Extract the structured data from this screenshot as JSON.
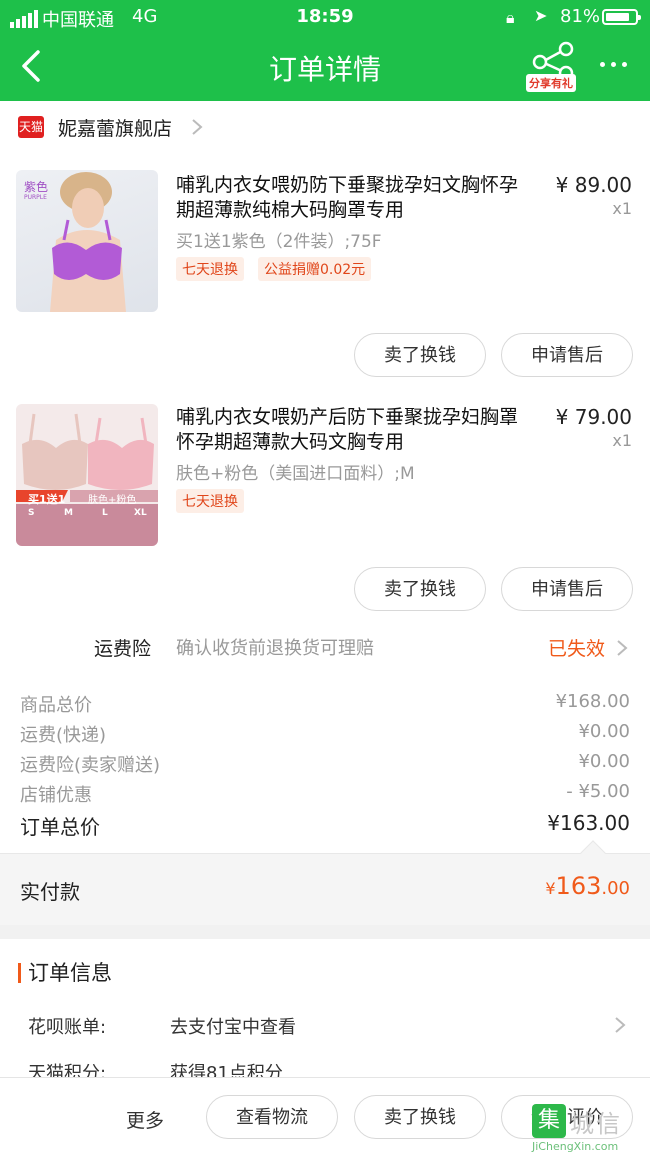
{
  "status_bar": {
    "carrier": "中国联通",
    "network": "4G",
    "time": "18:59",
    "battery": "81%",
    "battery_level": 0.81
  },
  "header": {
    "title": "订单详情",
    "share_badge": "分享有礼"
  },
  "shop": {
    "badge": "天猫",
    "name": "妮嘉蕾旗舰店"
  },
  "products": [
    {
      "title": "哺乳内衣女喂奶防下垂聚拢孕妇文胸怀孕期超薄款纯棉大码胸罩专用",
      "price": "¥ 89.00",
      "qty": "x1",
      "sku": "买1送1紫色（2件装）;75F",
      "tags": [
        "七天退换",
        "公益捐赠0.02元"
      ],
      "thumb_label": "紫色",
      "thumb_sub": "PURPLE",
      "buttons": [
        "卖了换钱",
        "申请售后"
      ]
    },
    {
      "title": "哺乳内衣女喂奶产后防下垂聚拢孕妇胸罩怀孕期超薄款大码文胸专用",
      "price": "¥ 79.00",
      "qty": "x1",
      "sku": "肤色+粉色（美国进口面料）;M",
      "tags": [
        "七天退换"
      ],
      "thumb_label": "买1送1",
      "thumb_sub": "肤色+粉色",
      "thumb_sizes": [
        "S",
        "M",
        "L",
        "XL"
      ],
      "buttons": [
        "卖了换钱",
        "申请售后"
      ]
    }
  ],
  "insurance": {
    "label": "运费险",
    "desc": "确认收货前退换货可理赔",
    "status": "已失效"
  },
  "summary": [
    {
      "label": "商品总价",
      "value": "¥168.00"
    },
    {
      "label": "运费(快递)",
      "value": "¥0.00"
    },
    {
      "label": "运费险(卖家赠送)",
      "value": "¥0.00"
    },
    {
      "label": "店铺优惠",
      "value": "- ¥5.00"
    }
  ],
  "total": {
    "label": "订单总价",
    "value": "¥163.00"
  },
  "paid": {
    "label": "实付款",
    "currency": "¥",
    "int": "163",
    "dec": ".00"
  },
  "order_info": {
    "title": "订单信息",
    "rows": [
      {
        "label": "花呗账单:",
        "value": "去支付宝中查看"
      },
      {
        "label": "天猫积分:",
        "value": "获得81点积分"
      }
    ]
  },
  "bottom_bar": {
    "more": "更多",
    "buttons": [
      "查看物流",
      "卖了换钱",
      "追加评价"
    ]
  },
  "watermark": {
    "glyph": "集",
    "text": "城信",
    "url": "JiChengXin.com"
  }
}
